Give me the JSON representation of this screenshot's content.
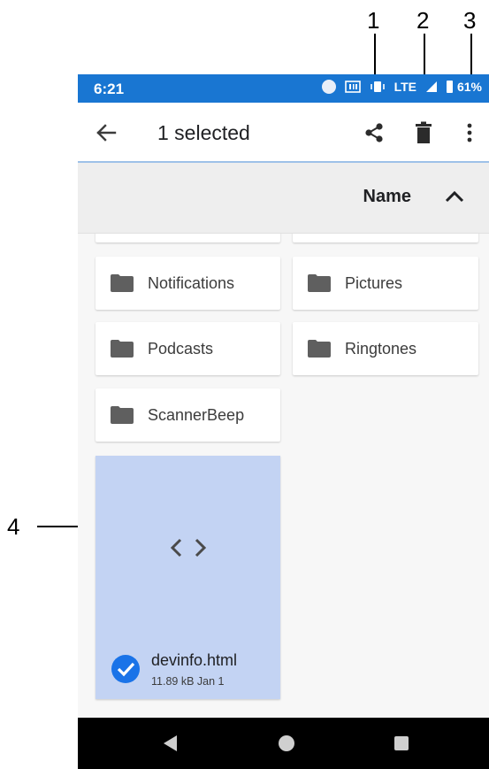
{
  "annotations": [
    "1",
    "2",
    "3",
    "4"
  ],
  "status_bar": {
    "time": "6:21",
    "network": "LTE",
    "battery": "61%",
    "background_color": "#1976d2"
  },
  "app_bar": {
    "title": "1 selected",
    "actions": [
      {
        "name": "share",
        "icon": "share-icon"
      },
      {
        "name": "delete",
        "icon": "trash-icon"
      },
      {
        "name": "more options",
        "icon": "more-vert-icon"
      }
    ]
  },
  "sort_bar": {
    "label": "Name",
    "direction": "ascending",
    "icon": "chevron-up-icon"
  },
  "folders": [
    {
      "label": "Notifications",
      "icon": "folder-icon"
    },
    {
      "label": "Pictures",
      "icon": "folder-icon"
    },
    {
      "label": "Podcasts",
      "icon": "folder-icon"
    },
    {
      "label": "Ringtones",
      "icon": "folder-icon"
    },
    {
      "label": "ScannerBeep",
      "icon": "folder-icon"
    }
  ],
  "file": {
    "name": "devinfo.html",
    "meta": "11.89 kB Jan 1",
    "selected": true,
    "icon": "code-icon",
    "selection_color": "#c3d3f3",
    "check_color": "#1a73e8"
  },
  "nav_bar": {
    "buttons": [
      "back-icon",
      "home-icon",
      "recents-icon"
    ]
  }
}
